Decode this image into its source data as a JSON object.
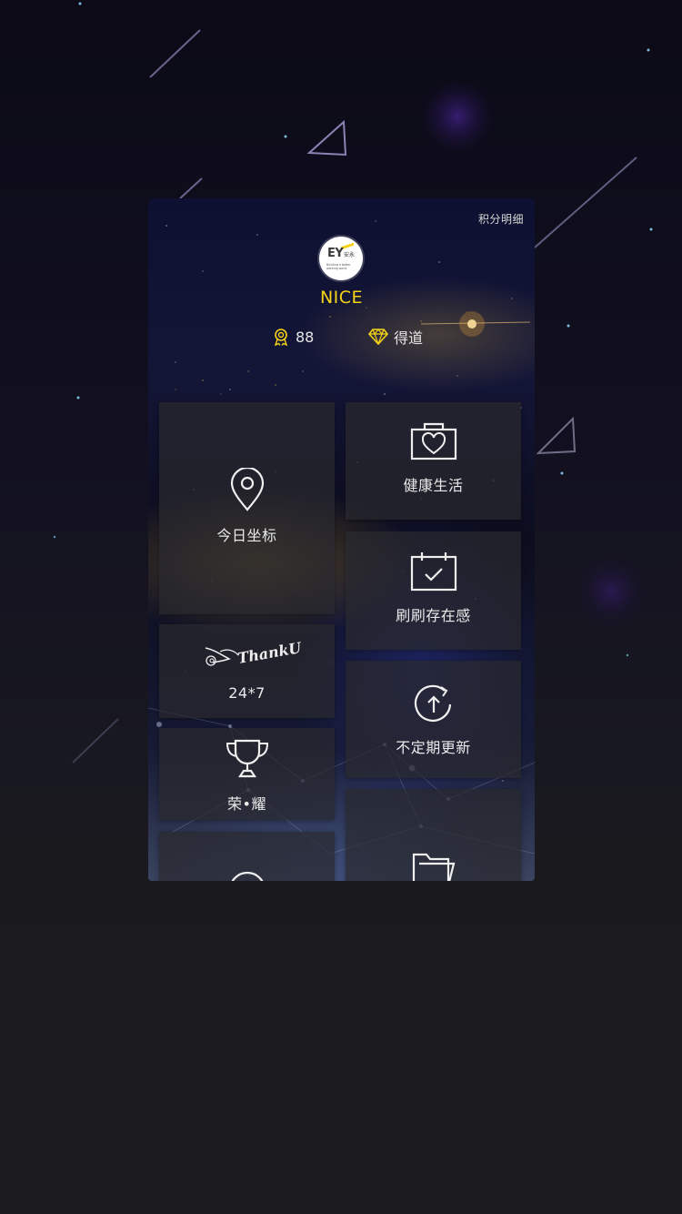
{
  "header": {
    "points_detail_label": "积分明细",
    "avatar_logo_text": "EY",
    "avatar_logo_cn": "安永",
    "avatar_logo_tagline": "Building a better working world",
    "username": "NICE"
  },
  "stats": {
    "points_value": "88",
    "level_label": "得道"
  },
  "tiles": {
    "location_label": "今日坐标",
    "health_label": "健康生活",
    "checkin_label": "刷刷存在感",
    "thanks_script": "ThankU",
    "thanks_label": "24*7",
    "update_label": "不定期更新",
    "honor_label": "荣•耀"
  },
  "colors": {
    "accent_yellow": "#f5d417",
    "tile_background": "#2b2b30",
    "page_background": "#1b1b1d"
  }
}
